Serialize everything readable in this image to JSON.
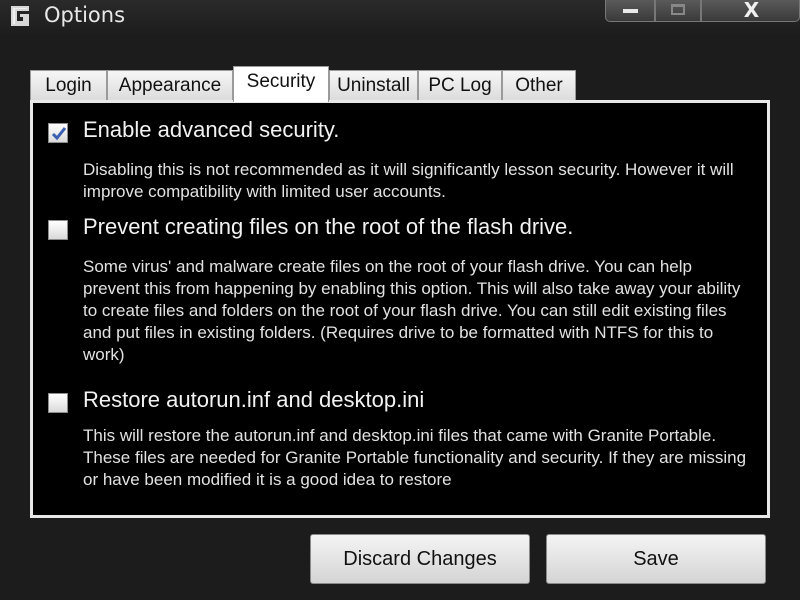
{
  "window": {
    "title": "Options",
    "close_glyph": "X",
    "icon": "granite-app-icon"
  },
  "tabs": [
    {
      "label": "Login",
      "active": false
    },
    {
      "label": "Appearance",
      "active": false
    },
    {
      "label": "Security",
      "active": true
    },
    {
      "label": "Uninstall",
      "active": false
    },
    {
      "label": "PC Log",
      "active": false
    },
    {
      "label": "Other",
      "active": false
    }
  ],
  "security": {
    "options": [
      {
        "label": "Enable advanced security.",
        "checked": true,
        "description": "Disabling this is not recommended as it will significantly lesson security. However it will improve compatibility with limited user accounts."
      },
      {
        "label": "Prevent creating files on the root of the flash drive.",
        "checked": false,
        "description": "Some virus' and malware create files on the root of your flash drive. You can help prevent this from happening by enabling this option. This will also take away your ability to create files and folders on the root of your flash drive. You can still edit existing files and put files in existing folders. (Requires drive to be formatted with NTFS for this to work)"
      },
      {
        "label": "Restore autorun.inf and desktop.ini",
        "checked": false,
        "description": "This will restore the autorun.inf and desktop.ini files that came with Granite Portable. These files are needed for Granite Portable functionality and security. If they are missing or have been modified it is a good idea to restore"
      }
    ]
  },
  "buttons": {
    "discard_label": "Discard Changes",
    "save_label": "Save"
  },
  "colors": {
    "panel_background": "#000000",
    "window_background": "#1c1c1c",
    "checkmark": "#3a5fb0"
  }
}
